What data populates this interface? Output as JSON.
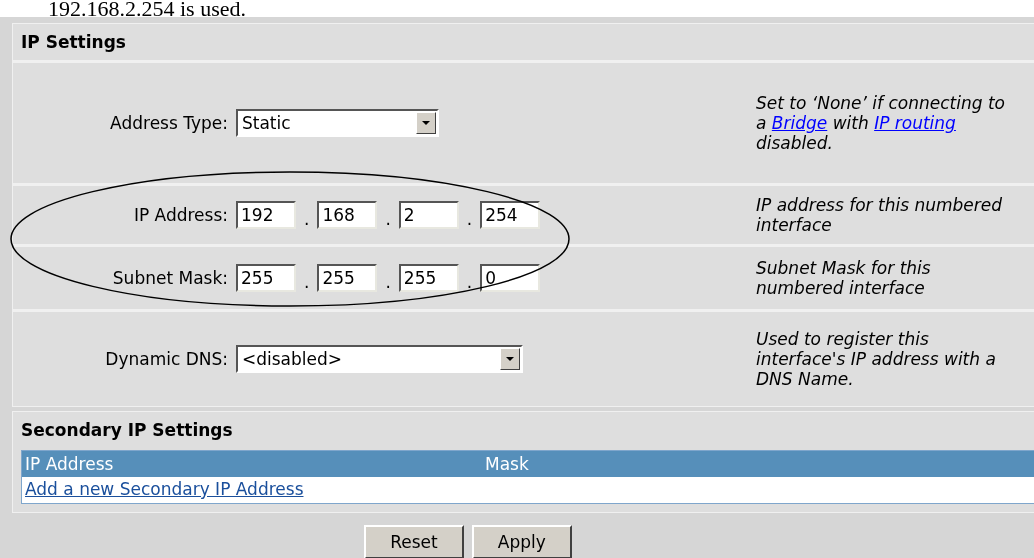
{
  "intro_text": "192.168.2.254 is used.",
  "ip_settings": {
    "title": "IP Settings",
    "rows": [
      {
        "kind": "select",
        "label": "Address Type:",
        "value": "Static",
        "help": [
          {
            "kind": "text",
            "text": "Set to ‘None’ if connecting to a "
          },
          {
            "kind": "link",
            "text": "Bridge"
          },
          {
            "kind": "text",
            "text": " with "
          },
          {
            "kind": "link",
            "text": "IP routing"
          },
          {
            "kind": "text",
            "text": " disabled."
          }
        ]
      },
      {
        "kind": "octets",
        "label": "IP Address:",
        "octets": [
          "192",
          "168",
          "2",
          "254"
        ],
        "separator": ".",
        "help": [
          {
            "kind": "text",
            "text": "IP address for this numbered interface"
          }
        ]
      },
      {
        "kind": "octets",
        "label": "Subnet Mask:",
        "octets": [
          "255",
          "255",
          "255",
          "0"
        ],
        "separator": ".",
        "help": [
          {
            "kind": "text",
            "text": "Subnet Mask for this numbered interface"
          }
        ]
      },
      {
        "kind": "select",
        "label": "Dynamic DNS:",
        "value": "<disabled>",
        "help": [
          {
            "kind": "text",
            "text": "Used to register this interface's IP address with a DNS Name."
          }
        ]
      }
    ]
  },
  "secondary_ip_settings": {
    "title": "Secondary IP Settings",
    "columns": [
      "IP Address",
      "Mask"
    ],
    "add_link": "Add a new Secondary IP Address"
  },
  "buttons": [
    "Reset",
    "Apply"
  ]
}
